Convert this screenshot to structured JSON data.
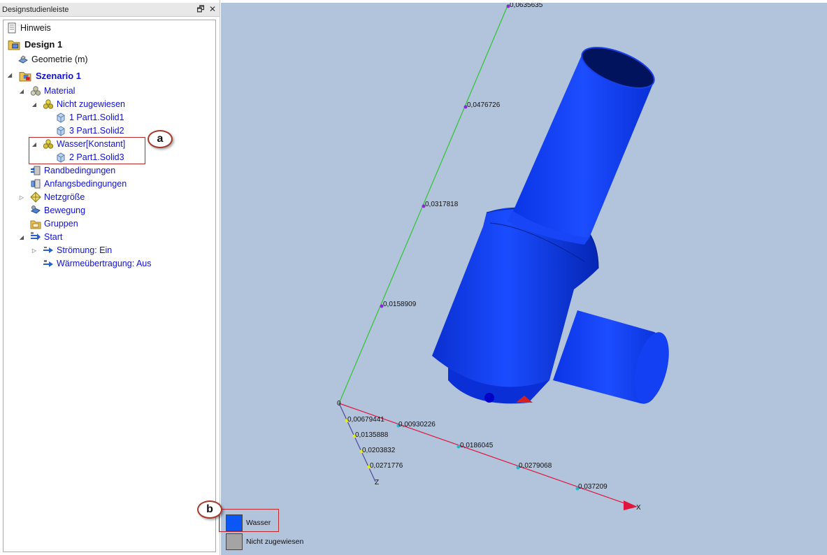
{
  "panel": {
    "title": "Designstudienleiste",
    "restore_glyph": "🗗",
    "close_glyph": "✕"
  },
  "tree": {
    "items": [
      {
        "label": "Hinweis",
        "icon": "document-icon"
      },
      {
        "label": "Design 1",
        "icon": "design-folder-icon"
      },
      {
        "label": "Geometrie (m)",
        "icon": "geometry-icon"
      },
      {
        "label": "Szenario 1",
        "icon": "scenario-icon"
      },
      {
        "label": "Material",
        "icon": "material-icon"
      },
      {
        "label": "Nicht zugewiesen",
        "icon": "material-icon"
      },
      {
        "label": "1 Part1.Solid1",
        "icon": "cube-icon"
      },
      {
        "label": "3 Part1.Solid2",
        "icon": "cube-icon"
      },
      {
        "label": "Wasser[Konstant]",
        "icon": "material-icon"
      },
      {
        "label": "2 Part1.Solid3",
        "icon": "cube-icon"
      },
      {
        "label": "Randbedingungen",
        "icon": "boundary-icon"
      },
      {
        "label": "Anfangsbedingungen",
        "icon": "initial-conditions-icon"
      },
      {
        "label": "Netzgröße",
        "icon": "mesh-icon"
      },
      {
        "label": "Bewegung",
        "icon": "motion-icon"
      },
      {
        "label": "Gruppen",
        "icon": "groups-icon"
      },
      {
        "label": "Start",
        "icon": "start-icon"
      },
      {
        "label": "Strömung: Ein",
        "icon": "flow-icon"
      },
      {
        "label": "Wärmeübertragung: Aus",
        "icon": "heat-icon"
      }
    ]
  },
  "callouts": {
    "a": "a",
    "b": "b"
  },
  "viewport": {
    "background": "#b2c3dc",
    "y_axis": {
      "color": "#2ec52e",
      "ticks": [
        "0",
        "0,0158909",
        "0,0317818",
        "0,0476726",
        "0,0635635"
      ]
    },
    "x_axis": {
      "color": "#e0143c",
      "label": "X",
      "ticks": [
        "0,00930226",
        "0,0186045",
        "0,0279068",
        "0,037209"
      ]
    },
    "z_axis": {
      "color": "#4a4a9a",
      "label": "Z",
      "ticks": [
        "0,00679441",
        "0,0135888",
        "0,0203832",
        "0,0271776"
      ]
    },
    "model_color": "#0a3ef0"
  },
  "legend": {
    "items": [
      {
        "label": "Wasser",
        "color": "#0a57f5"
      },
      {
        "label": "Nicht zugewiesen",
        "color": "#a4a4a4"
      }
    ]
  }
}
